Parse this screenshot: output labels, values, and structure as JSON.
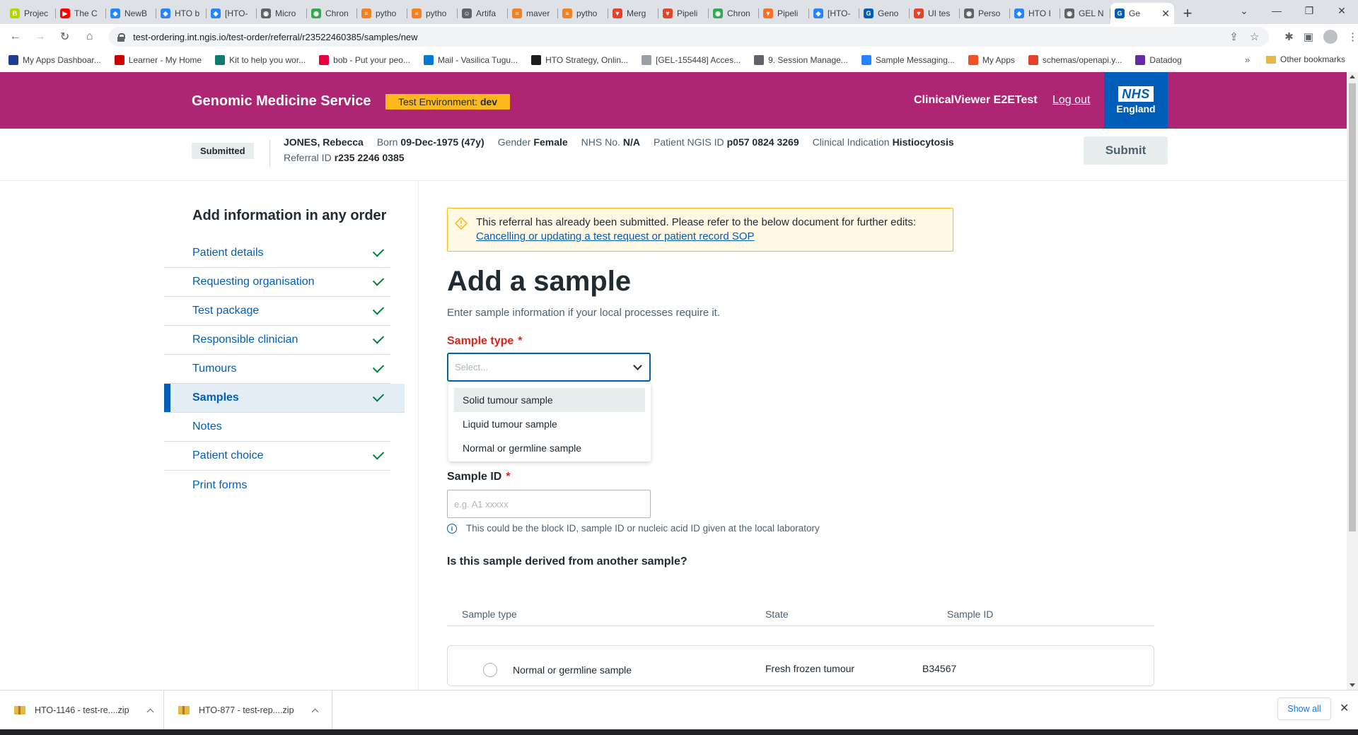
{
  "browser": {
    "tabs": [
      {
        "title": "Projec",
        "color": "#b6d400",
        "glyph": "B"
      },
      {
        "title": "The C",
        "color": "#ff0000",
        "glyph": "▶"
      },
      {
        "title": "NewB",
        "color": "#2684ff",
        "glyph": "◆"
      },
      {
        "title": "HTO b",
        "color": "#2684ff",
        "glyph": "◆"
      },
      {
        "title": "[HTO-",
        "color": "#2684ff",
        "glyph": "◆"
      },
      {
        "title": "Micro",
        "color": "#5f6368",
        "glyph": "◉"
      },
      {
        "title": "Chron",
        "color": "#34a853",
        "glyph": "◉"
      },
      {
        "title": "pytho",
        "color": "#f48024",
        "glyph": "≡"
      },
      {
        "title": "pytho",
        "color": "#f48024",
        "glyph": "≡"
      },
      {
        "title": "Artifa",
        "color": "#5f6368",
        "glyph": "☺"
      },
      {
        "title": "maver",
        "color": "#f48024",
        "glyph": "≡"
      },
      {
        "title": "pytho",
        "color": "#f48024",
        "glyph": "≡"
      },
      {
        "title": "Merg",
        "color": "#e24329",
        "glyph": "▼"
      },
      {
        "title": "Pipeli",
        "color": "#e24329",
        "glyph": "▼"
      },
      {
        "title": "Chron",
        "color": "#34a853",
        "glyph": "◉"
      },
      {
        "title": "Pipeli",
        "color": "#fc6d26",
        "glyph": "▼"
      },
      {
        "title": "[HTO-",
        "color": "#2684ff",
        "glyph": "◆"
      },
      {
        "title": "Geno",
        "color": "#005eb8",
        "glyph": "G"
      },
      {
        "title": "UI tes",
        "color": "#e24329",
        "glyph": "▼"
      },
      {
        "title": "Perso",
        "color": "#5f6368",
        "glyph": "◉"
      },
      {
        "title": "HTO I",
        "color": "#2684ff",
        "glyph": "◆"
      },
      {
        "title": "GEL N",
        "color": "#5f6368",
        "glyph": "◉"
      }
    ],
    "active_tab": {
      "title": "Ge",
      "color": "#005eb8",
      "glyph": "G"
    },
    "url": "test-ordering.int.ngis.io/test-order/referral/r23522460385/samples/new",
    "bookmarks": [
      {
        "label": "My Apps Dashboar...",
        "color": "#1c3f94"
      },
      {
        "label": "Learner - My Home",
        "color": "#cc0000"
      },
      {
        "label": "Kit to help you wor...",
        "color": "#0f7b6c"
      },
      {
        "label": "bob - Put your peo...",
        "color": "#e8003d"
      },
      {
        "label": "Mail - Vasilica Tugu...",
        "color": "#0078d4"
      },
      {
        "label": "HTO Strategy, Onlin...",
        "color": "#1d1d1d"
      },
      {
        "label": "[GEL-155448] Acces...",
        "color": "#9aa0a6"
      },
      {
        "label": "9. Session Manage...",
        "color": "#5f6368"
      },
      {
        "label": "Sample Messaging...",
        "color": "#2684ff"
      },
      {
        "label": "My Apps",
        "color": "#f25022"
      },
      {
        "label": "schemas/openapi.y...",
        "color": "#e24329"
      },
      {
        "label": "Datadog",
        "color": "#632ca6"
      }
    ],
    "bookmarks_more": "»",
    "other_bookmarks": "Other bookmarks"
  },
  "header": {
    "brand": "Genomic Medicine Service",
    "env_prefix": "Test Environment:",
    "env_value": "dev",
    "user": "ClinicalViewer E2ETest",
    "logout": "Log out",
    "logo_nhs": "NHS",
    "logo_region": "England"
  },
  "patient": {
    "status": "Submitted",
    "name": "JONES, Rebecca",
    "born_label": "Born",
    "born_value": "09-Dec-1975 (47y)",
    "gender_label": "Gender",
    "gender_value": "Female",
    "nhs_label": "NHS No.",
    "nhs_value": "N/A",
    "ngis_label": "Patient NGIS ID",
    "ngis_value": "p057 0824 3269",
    "ci_label": "Clinical Indication",
    "ci_value": "Histiocytosis",
    "referral_label": "Referral ID",
    "referral_value": "r235 2246 0385",
    "submit": "Submit"
  },
  "sidebar": {
    "title": "Add information in any order",
    "steps": [
      {
        "label": "Patient details",
        "done": true
      },
      {
        "label": "Requesting organisation",
        "done": true
      },
      {
        "label": "Test package",
        "done": true
      },
      {
        "label": "Responsible clinician",
        "done": true
      },
      {
        "label": "Tumours",
        "done": true
      },
      {
        "label": "Samples",
        "done": true,
        "active": true
      },
      {
        "label": "Notes",
        "done": false
      },
      {
        "label": "Patient choice",
        "done": true
      },
      {
        "label": "Print forms",
        "done": false
      }
    ]
  },
  "main": {
    "alert_text": "This referral has already been submitted. Please refer to the below document for further edits:",
    "alert_link": "Cancelling or updating a test request or patient record SOP",
    "title": "Add a sample",
    "description": "Enter sample information if your local processes require it.",
    "sample_type_label": "Sample type",
    "required_mark": "*",
    "sample_type_placeholder": "Select...",
    "sample_type_options": [
      "Solid tumour sample",
      "Liquid tumour sample",
      "Normal or germline sample"
    ],
    "sample_id_label": "Sample ID",
    "sample_id_placeholder": "e.g. A1 xxxxx",
    "sample_id_hint": "This could be the block ID, sample ID or nucleic acid ID given at the local laboratory",
    "derived_question": "Is this sample derived from another sample?",
    "table": {
      "columns": [
        "Sample type",
        "State",
        "Sample ID"
      ],
      "rows": [
        {
          "type": "Normal or germline sample",
          "state": "Fresh frozen tumour",
          "id": "B34567"
        }
      ]
    }
  },
  "downloads": {
    "items": [
      "HTO-1146 - test-re....zip",
      "HTO-877 - test-rep....zip"
    ],
    "show_all": "Show all"
  },
  "colors": {
    "header_bg": "#ae2573",
    "nhs_blue": "#005eb8",
    "env_badge": "#ffb81c",
    "required_red": "#d5281b",
    "done_green": "#007f3b"
  }
}
